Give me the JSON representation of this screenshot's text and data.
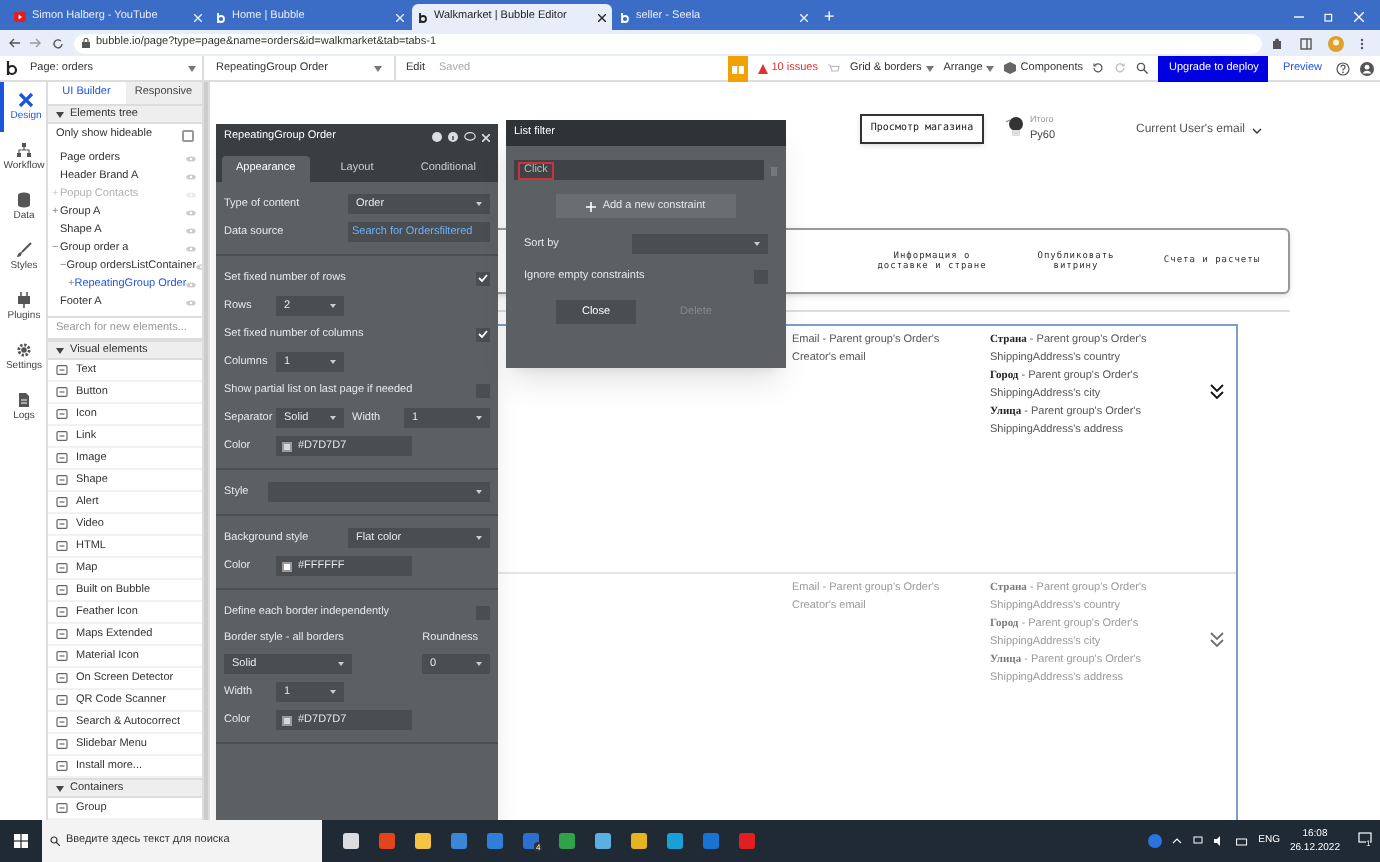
{
  "browser": {
    "tabs": [
      {
        "title": "Simon Halberg - YouTube",
        "selected": false
      },
      {
        "title": "Home | Bubble",
        "selected": false
      },
      {
        "title": "Walkmarket | Bubble Editor",
        "selected": true
      },
      {
        "title": "seller - Seela",
        "selected": false
      }
    ],
    "new_tab": "+",
    "address": "bubble.io/page?type=page&name=orders&id=walkmarket&tab=tabs-1"
  },
  "toolbar": {
    "page": "Page: orders",
    "element": "RepeatingGroup Order",
    "edit": "Edit",
    "saved": "Saved",
    "issues": "10 issues",
    "grid": "Grid & borders",
    "arrange": "Arrange",
    "components": "Components",
    "deploy": "Upgrade to deploy",
    "preview": "Preview"
  },
  "rail": [
    {
      "label": "Design",
      "selected": true
    },
    {
      "label": "Workflow",
      "selected": false
    },
    {
      "label": "Data",
      "selected": false
    },
    {
      "label": "Styles",
      "selected": false
    },
    {
      "label": "Plugins",
      "selected": false
    },
    {
      "label": "Settings",
      "selected": false
    },
    {
      "label": "Logs",
      "selected": false
    }
  ],
  "sidebar": {
    "tabs": [
      {
        "label": "UI Builder",
        "selected": true
      },
      {
        "label": "Responsive",
        "selected": false
      }
    ],
    "tree_heading": "Elements tree",
    "hideable": {
      "label": "Only show hideable",
      "checked": false
    },
    "tree": [
      {
        "kind": "leaf",
        "label": "Page orders",
        "selected": false,
        "hidden": false
      },
      {
        "kind": "leaf",
        "label": "Header Brand A",
        "selected": false,
        "hidden": false
      },
      {
        "kind": "branch",
        "label": "Popup Contacts",
        "selected": false,
        "hidden": true,
        "toggle": "+"
      },
      {
        "kind": "branch",
        "label": "Group A",
        "selected": false,
        "hidden": false,
        "toggle": "+"
      },
      {
        "kind": "leaf",
        "label": "Shape A",
        "selected": false,
        "hidden": false
      },
      {
        "kind": "branch",
        "label": "Group order a",
        "selected": false,
        "hidden": false,
        "toggle": "−",
        "children": [
          {
            "kind": "branch",
            "label": "Group ordersListContainer",
            "selected": false,
            "hidden": false,
            "toggle": "−",
            "children": [
              {
                "kind": "branch",
                "label": "RepeatingGroup Order",
                "selected": true,
                "hidden": false,
                "toggle": "+"
              }
            ]
          }
        ]
      },
      {
        "kind": "leaf",
        "label": "Footer A",
        "selected": false,
        "hidden": false
      }
    ],
    "search_placeholder": "Search for new elements...",
    "groups": [
      {
        "heading": "Visual elements",
        "items": [
          "Text",
          "Button",
          "Icon",
          "Link",
          "Image",
          "Shape",
          "Alert",
          "Video",
          "HTML",
          "Map",
          "Built on Bubble",
          "Feather Icon",
          "Maps Extended",
          "Material Icon",
          "On Screen Detector",
          "QR Code Scanner",
          "Search & Autocorrect",
          "Slidebar Menu",
          "Install more..."
        ]
      },
      {
        "heading": "Containers",
        "items": [
          "Group"
        ]
      }
    ]
  },
  "properties": {
    "title": "RepeatingGroup Order",
    "tabs": [
      {
        "label": "Appearance",
        "selected": true
      },
      {
        "label": "Layout",
        "selected": false
      },
      {
        "label": "Conditional",
        "selected": false
      }
    ],
    "sections": [
      {
        "rows": [
          {
            "kind": "dropdown",
            "label": "Type of content",
            "value": "Order"
          },
          {
            "kind": "link",
            "label": "Data source",
            "value": "Search for Ordersfiltered"
          }
        ]
      },
      {
        "rows": [
          {
            "kind": "checkbox",
            "label": "Set fixed number of rows",
            "checked": true
          },
          {
            "kind": "small",
            "label": "Rows",
            "value": "2"
          },
          {
            "kind": "checkbox",
            "label": "Set fixed number of columns",
            "checked": true
          },
          {
            "kind": "small",
            "label": "Columns",
            "value": "1"
          },
          {
            "kind": "checkbox",
            "label": "Show partial list on last page if needed",
            "checked": false
          },
          {
            "kind": "pair",
            "label": "Separator",
            "value": "Solid",
            "label2": "Width",
            "value2": "1"
          },
          {
            "kind": "color",
            "label": "Color",
            "value": "#D7D7D7"
          }
        ]
      },
      {
        "rows": [
          {
            "kind": "wide",
            "label": "Style"
          }
        ]
      },
      {
        "rows": [
          {
            "kind": "dropdown",
            "label": "Background style",
            "value": "Flat color"
          },
          {
            "kind": "color",
            "label": "Color",
            "value": "#FFFFFF"
          }
        ]
      },
      {
        "rows": [
          {
            "kind": "checkbox",
            "label": "Define each border independently",
            "checked": false
          },
          {
            "kind": "stacked",
            "label": "Border style - all borders",
            "value": "Solid",
            "label2": "Roundness",
            "value2": "0"
          },
          {
            "kind": "small",
            "label": "Width",
            "value": "1"
          },
          {
            "kind": "color",
            "label": "Color",
            "value": "#D7D7D7"
          }
        ]
      }
    ]
  },
  "list_filter": {
    "title": "List filter",
    "constraint": "Click",
    "add": "Add a new constraint",
    "sort_label": "Sort by",
    "ignore": {
      "label": "Ignore empty constraints",
      "checked": false
    },
    "close": "Close",
    "delete": "Delete"
  },
  "canvas": {
    "shop_button": "Просмотр магазина",
    "total_label": "Итого",
    "total": "Py60",
    "user_menu": "Current User's email",
    "nav": [
      "Информация о доставке и стране",
      "Опубликовать витрину",
      "Счета и расчеты"
    ],
    "rows": [
      {
        "dimmed": false,
        "email": "Email - Parent group's Order's Creator's email",
        "address": [
          "**Страна** - Parent group's Order's ShippingAddress's country",
          "**Город** - Parent group's Order's ShippingAddress's city",
          "**Улица** - Parent group's Order's ShippingAddress's address"
        ]
      },
      {
        "dimmed": true,
        "email": "Email - Parent group's Order's Creator's email",
        "address": [
          "**Страна** - Parent group's Order's ShippingAddress's country",
          "**Город** - Parent group's Order's ShippingAddress's city",
          "**Улица** - Parent group's Order's ShippingAddress's address"
        ]
      }
    ]
  },
  "taskbar": {
    "search_placeholder": "Введите здесь текст для поиска",
    "badge": "4",
    "language": "ENG",
    "time": "16:08",
    "date": "26.12.2022",
    "notifications": "1"
  }
}
